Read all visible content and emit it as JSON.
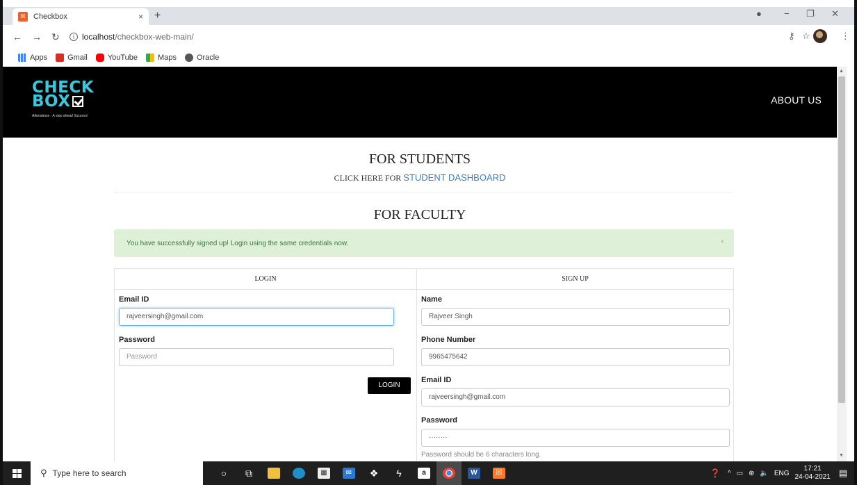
{
  "browser": {
    "tab_title": "Checkbox",
    "tab_close": "×",
    "new_tab": "+",
    "url_host": "localhost",
    "url_path": "/checkbox-web-main/",
    "bookmarks": [
      {
        "label": "Apps",
        "color": "#4285f4"
      },
      {
        "label": "Gmail",
        "color": "#d93025"
      },
      {
        "label": "YouTube",
        "color": "#ff0000"
      },
      {
        "label": "Maps",
        "color": "#34a853"
      },
      {
        "label": "Oracle",
        "color": "#555555"
      }
    ]
  },
  "header": {
    "logo_line1": "CHECK",
    "logo_line2": "BOX",
    "tagline": "Attendance - A step ahead Success!",
    "about_label": "ABOUT US",
    "brand_color": "#3cc8dc"
  },
  "students": {
    "title": "FOR STUDENTS",
    "prefix": "CLICK HERE FOR ",
    "link": "STUDENT DASHBOARD"
  },
  "faculty": {
    "title": "FOR FACULTY",
    "alert": "You have successfully signed up! Login using the same credentials now.",
    "alert_close": "×"
  },
  "login": {
    "heading": "LOGIN",
    "email_label": "Email ID",
    "email_value": "rajveersingh@gmail.com",
    "password_label": "Password",
    "password_placeholder": "Password",
    "button": "LOGIN"
  },
  "signup": {
    "heading": "SIGN UP",
    "name_label": "Name",
    "name_value": "Rajveer Singh",
    "phone_label": "Phone Number",
    "phone_value": "9965475642",
    "email_label": "Email ID",
    "email_value": "rajveersingh@gmail.com",
    "password_label": "Password",
    "password_value": "········",
    "password_help": "Password should be 6 characters long."
  },
  "taskbar": {
    "search_placeholder": "Type here to search",
    "lang": "ENG",
    "time": "17:21",
    "date": "24-04-2021"
  }
}
